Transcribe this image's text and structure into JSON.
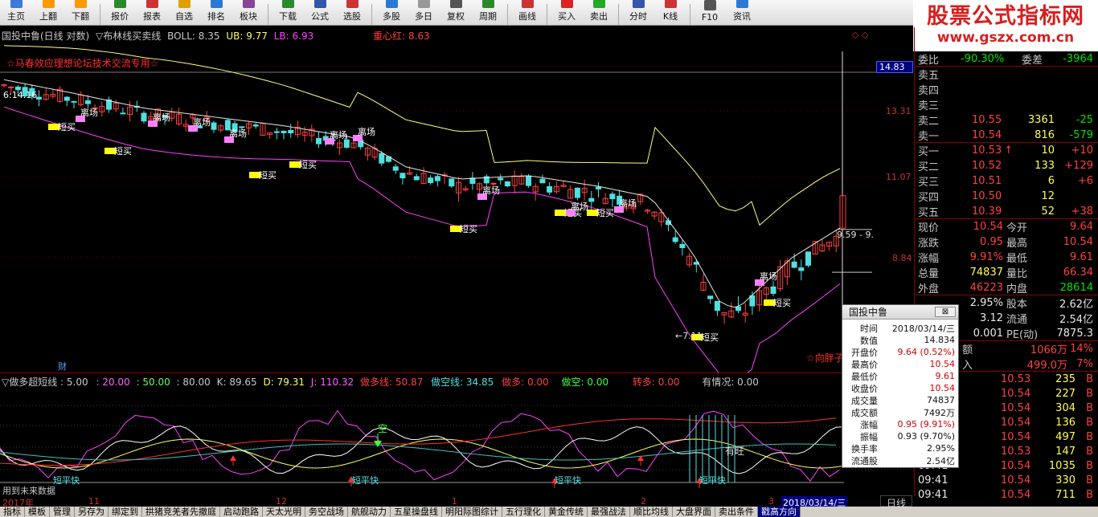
{
  "toolbar": [
    {
      "label": "主页",
      "icon": "home-icon",
      "color": "#3a7bd5"
    },
    {
      "label": "上翻",
      "icon": "page-up-icon",
      "color": "#ff9900"
    },
    {
      "label": "下翻",
      "icon": "page-down-icon",
      "color": "#ff9900"
    },
    {
      "label": "报价",
      "icon": "quote-icon",
      "color": "#2a8a2a"
    },
    {
      "label": "报表",
      "icon": "report-icon",
      "color": "#cc3333"
    },
    {
      "label": "自选",
      "icon": "watchlist-icon",
      "color": "#e0a000"
    },
    {
      "label": "排名",
      "icon": "rank-icon",
      "color": "#2a7ad5"
    },
    {
      "label": "板块",
      "icon": "sector-icon",
      "color": "#884499"
    },
    {
      "label": "下载",
      "icon": "download-icon",
      "color": "#2a8a2a"
    },
    {
      "label": "公式",
      "icon": "formula-icon",
      "color": "#3355aa"
    },
    {
      "label": "选股",
      "icon": "stock-picker-icon",
      "color": "#cc3333"
    },
    {
      "label": "多股",
      "icon": "multi-stock-icon",
      "color": "#2a7ad5"
    },
    {
      "label": "多日",
      "icon": "multi-day-icon",
      "color": "#999999"
    },
    {
      "label": "复权",
      "icon": "adjust-icon",
      "color": "#555555"
    },
    {
      "label": "周期",
      "icon": "period-icon",
      "color": "#2a8a2a"
    },
    {
      "label": "画线",
      "icon": "draw-line-icon",
      "color": "#cc3333"
    },
    {
      "label": "买入",
      "icon": "buy-icon",
      "color": "#dd2222"
    },
    {
      "label": "卖出",
      "icon": "sell-icon",
      "color": "#22aa22"
    },
    {
      "label": "分时",
      "icon": "intraday-icon",
      "color": "#3355aa"
    },
    {
      "label": "K线",
      "icon": "kline-icon",
      "color": "#cc3333"
    },
    {
      "label": "F10",
      "icon": "f10-icon",
      "color": "#555555"
    },
    {
      "label": "资讯",
      "icon": "news-icon",
      "color": "#2a7ad5"
    }
  ],
  "brand": {
    "title": "股票公式指标网",
    "url": "www.gszx.com.cn"
  },
  "main_header": {
    "stock": "国投中鲁(日线 对数)",
    "indicator": "▽布林线买卖线",
    "boll": "BOLL: 8.35",
    "ub": "UB: 9.77",
    "lb": "LB: 6.93",
    "center": "重心红: 8.63"
  },
  "main_labels": {
    "banner": "☆马春效应理想论坛技术交流专用☆",
    "start_price": "6:14.16",
    "high_tag": "9.59 - 9.",
    "low_tag": "←7.11",
    "tag_bottom": "☆向胖子",
    "finance": "财",
    "buy": "短买",
    "exit": "离场"
  },
  "axis": {
    "top_value": "14.83",
    "levels": [
      "13.31",
      "11.07",
      "8.84"
    ]
  },
  "sub_header": {
    "name": "▽做多超短线 : 5.00",
    "p1": ": 20.00",
    "p2": ": 50.00",
    "p3": ": 80.00",
    "k": "K: 89.65",
    "d": "D: 79.31",
    "j": "J: 110.32",
    "long": "做多线: 50.87",
    "short": "做空线: 34.85",
    "duo": "做多: 0.00",
    "kong": "做空: 0.00",
    "zhuan": "转多: 0.00",
    "info": "有情况: 0.00"
  },
  "sub_labels": {
    "kong": "空",
    "ping": "短平快",
    "youwang": "有旺",
    "future": "用到未来数据"
  },
  "dates": {
    "y": "2017年",
    "m11": "11",
    "m12": "12",
    "m1": "1",
    "m2": "2",
    "m3": "3",
    "current": "2018/03/14/三"
  },
  "tooltip": {
    "title": "国投中鲁",
    "rows": [
      {
        "k": "时间",
        "v": "2018/03/14/三",
        "c": "#111"
      },
      {
        "k": "数值",
        "v": "14.834",
        "c": "#111"
      },
      {
        "k": "开盘价",
        "v": "9.64 (0.52%)",
        "c": "#d00000"
      },
      {
        "k": "最高价",
        "v": "10.54",
        "c": "#d00000"
      },
      {
        "k": "最低价",
        "v": "9.61",
        "c": "#d00000"
      },
      {
        "k": "收盘价",
        "v": "10.54",
        "c": "#d00000"
      },
      {
        "k": "成交量",
        "v": "74837",
        "c": "#111"
      },
      {
        "k": "成交额",
        "v": "7492万",
        "c": "#111"
      },
      {
        "k": "涨幅",
        "v": "0.95 (9.91%)",
        "c": "#d00000"
      },
      {
        "k": "振幅",
        "v": "0.93 (9.70%)",
        "c": "#111"
      },
      {
        "k": "换手率",
        "v": "2.95%",
        "c": "#111"
      },
      {
        "k": "流通股",
        "v": "2.54亿",
        "c": "#111"
      }
    ]
  },
  "quote": {
    "weibi": {
      "label": "委比",
      "value": "-90.30%",
      "label2": "委差",
      "value2": "-3964"
    },
    "sell": [
      {
        "label": "卖五",
        "price": "",
        "vol": "",
        "chg": ""
      },
      {
        "label": "卖四",
        "price": "",
        "vol": "",
        "chg": ""
      },
      {
        "label": "卖三",
        "price": "",
        "vol": "",
        "chg": ""
      },
      {
        "label": "卖二",
        "price": "10.55",
        "vol": "3361",
        "chg": "-25"
      },
      {
        "label": "卖一",
        "price": "10.54",
        "vol": "816",
        "chg": "-579"
      }
    ],
    "buy": [
      {
        "label": "买一",
        "price": "10.53",
        "vol": "10",
        "chg": "+10",
        "arrow": "↑"
      },
      {
        "label": "买二",
        "price": "10.52",
        "vol": "133",
        "chg": "+129",
        "arrow": ""
      },
      {
        "label": "买三",
        "price": "10.51",
        "vol": "6",
        "chg": "+6",
        "arrow": ""
      },
      {
        "label": "买四",
        "price": "10.50",
        "vol": "12",
        "chg": "",
        "arrow": ""
      },
      {
        "label": "买五",
        "price": "10.39",
        "vol": "52",
        "chg": "+38",
        "arrow": ""
      }
    ],
    "stats": [
      {
        "l1": "现价",
        "v1": "10.54",
        "c1": "red",
        "l2": "今开",
        "v2": "9.64",
        "c2": "red"
      },
      {
        "l1": "涨跌",
        "v1": "0.95",
        "c1": "red",
        "l2": "最高",
        "v2": "10.54",
        "c2": "red"
      },
      {
        "l1": "涨幅",
        "v1": "9.91%",
        "c1": "red",
        "l2": "最低",
        "v2": "9.61",
        "c2": "red"
      },
      {
        "l1": "总量",
        "v1": "74837",
        "c1": "yel",
        "l2": "量比",
        "v2": "66.34",
        "c2": "red"
      },
      {
        "l1": "外盘",
        "v1": "46223",
        "c1": "red",
        "l2": "内盘",
        "v2": "28614",
        "c2": "grn"
      }
    ],
    "fin": [
      {
        "l1": "",
        "v1": "2.95%",
        "l2": "股本",
        "v2": "2.62亿"
      },
      {
        "l1": "",
        "v1": "3.12",
        "l2": "流通",
        "v2": "2.54亿"
      },
      {
        "l1": "",
        "v1": "0.001",
        "l2": "PE(动)",
        "v2": "7875.3"
      }
    ],
    "flow": [
      {
        "label": "额",
        "value": "1066万",
        "pct": "14%"
      },
      {
        "label": "入",
        "value": "499.0万",
        "pct": "7%"
      }
    ],
    "ticks": [
      {
        "time": "",
        "price": "10.53",
        "vol": "235",
        "side": "B"
      },
      {
        "time": "",
        "price": "10.54",
        "vol": "227",
        "side": "B"
      },
      {
        "time": "",
        "price": "10.54",
        "vol": "304",
        "side": "B"
      },
      {
        "time": "",
        "price": "10.54",
        "vol": "136",
        "side": "B"
      },
      {
        "time": "",
        "price": "10.54",
        "vol": "497",
        "side": "B"
      },
      {
        "time": "",
        "price": "10.53",
        "vol": "147",
        "side": "B"
      },
      {
        "time": "09:41",
        "price": "10.54",
        "vol": "1035",
        "side": "B"
      },
      {
        "time": "09:41",
        "price": "10.54",
        "vol": "330",
        "side": "B"
      },
      {
        "time": "09:41",
        "price": "10.54",
        "vol": "711",
        "side": "B"
      }
    ]
  },
  "day_tab": "日线",
  "tabs": [
    "指标",
    "模板",
    "管理",
    "另存为",
    "绑定到",
    "拱猪竞羌者先撤庭",
    "启动跑路",
    "天太光明",
    "务空战场",
    "航舰动力",
    "五星操盘线",
    "明阳际图综计",
    "五行理化",
    "黄金传统",
    "最强战法",
    "顺比均线",
    "大盘界面",
    "卖出条件",
    "戳高方向"
  ]
}
